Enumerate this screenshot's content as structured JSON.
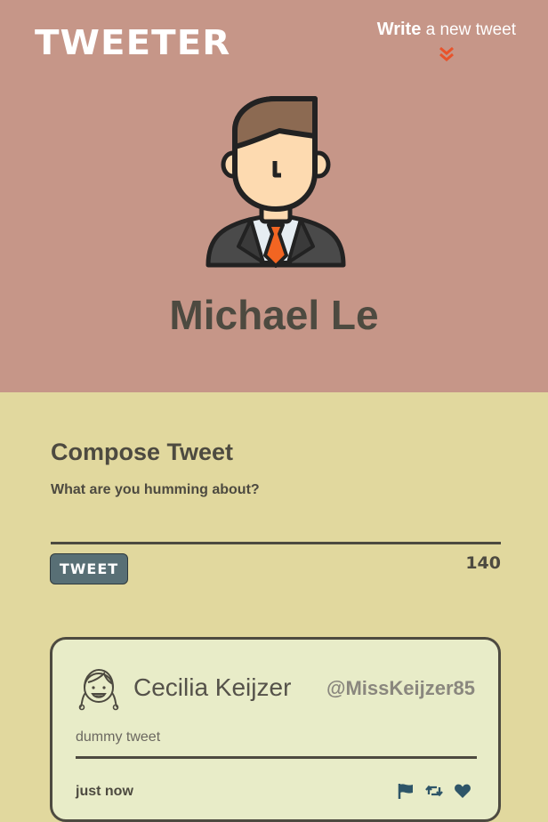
{
  "header": {
    "brand": "TWEETER",
    "write_bold": "Write",
    "write_rest": " a new tweet"
  },
  "profile": {
    "name": "Michael Le"
  },
  "compose": {
    "title": "Compose Tweet",
    "placeholder": "What are you humming about?",
    "button_label": "TWEET",
    "counter": "140"
  },
  "tweets": [
    {
      "name": "Cecilia Keijzer",
      "handle": "@MissKeijzer85",
      "text": "dummy tweet",
      "time": "just now",
      "actions": [
        "flag-icon",
        "retweet-icon",
        "heart-icon"
      ]
    }
  ],
  "colors": {
    "header_bg": "#c69688",
    "page_bg": "#e1d89e",
    "card_bg": "#e8ecc8",
    "button_bg": "#586f75",
    "accent": "#e8532b",
    "text": "#4d4a40"
  }
}
